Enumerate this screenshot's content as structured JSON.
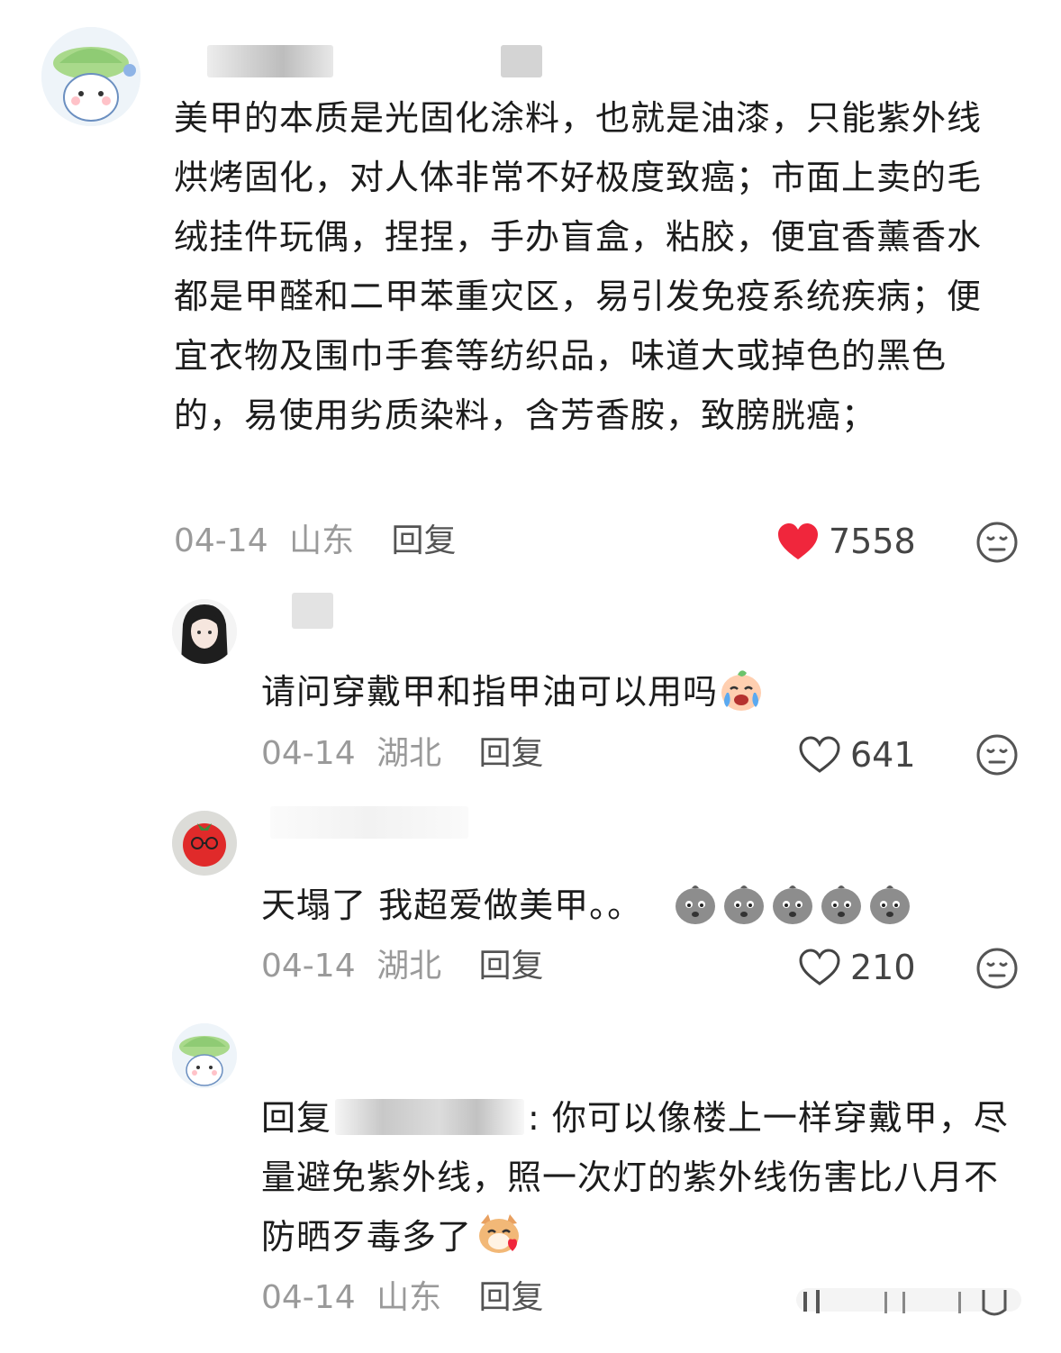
{
  "comments": [
    {
      "text": "美甲的本质是光固化涂料，也就是油漆，只能紫外线烘烤固化，对人体非常不好极度致癌；市面上卖的毛绒挂件玩偶，捏捏，手办盲盒，粘胶，便宜香薰香水都是甲醛和二甲苯重灾区，易引发免疫系统疾病；便宜衣物及围巾手套等纺织品，味道大或掉色的黑色的，易使用劣质染料，含芳香胺，致膀胱癌；",
      "date": "04-14",
      "location": "山东",
      "reply_label": "回复",
      "likes": "7558",
      "liked": true
    },
    {
      "text": "请问穿戴甲和指甲油可以用吗",
      "date": "04-14",
      "location": "湖北",
      "reply_label": "回复",
      "likes": "641",
      "liked": false
    },
    {
      "text": "天塌了 我超爱做美甲。。",
      "date": "04-14",
      "location": "湖北",
      "reply_label": "回复",
      "likes": "210",
      "liked": false
    },
    {
      "reply_prefix": "回复",
      "text": ": 你可以像楼上一样穿戴甲，尽量避免紫外线，照一次灯的紫外线伤害比八月不防晒歹毒多了",
      "date": "04-14",
      "location": "山东",
      "reply_label": "回复"
    }
  ],
  "icons": {
    "like_filled": "heart-filled-icon",
    "like_outline": "heart-outline-icon",
    "dislike": "dislike-face-icon",
    "emoji_cry": "crying-emoji",
    "emoji_sad": "sad-gray-emoji",
    "emoji_cat": "cat-heart-emoji"
  },
  "colors": {
    "heart": "#f0263c",
    "meta": "#9a9a9a",
    "text": "#1c1c1c"
  }
}
